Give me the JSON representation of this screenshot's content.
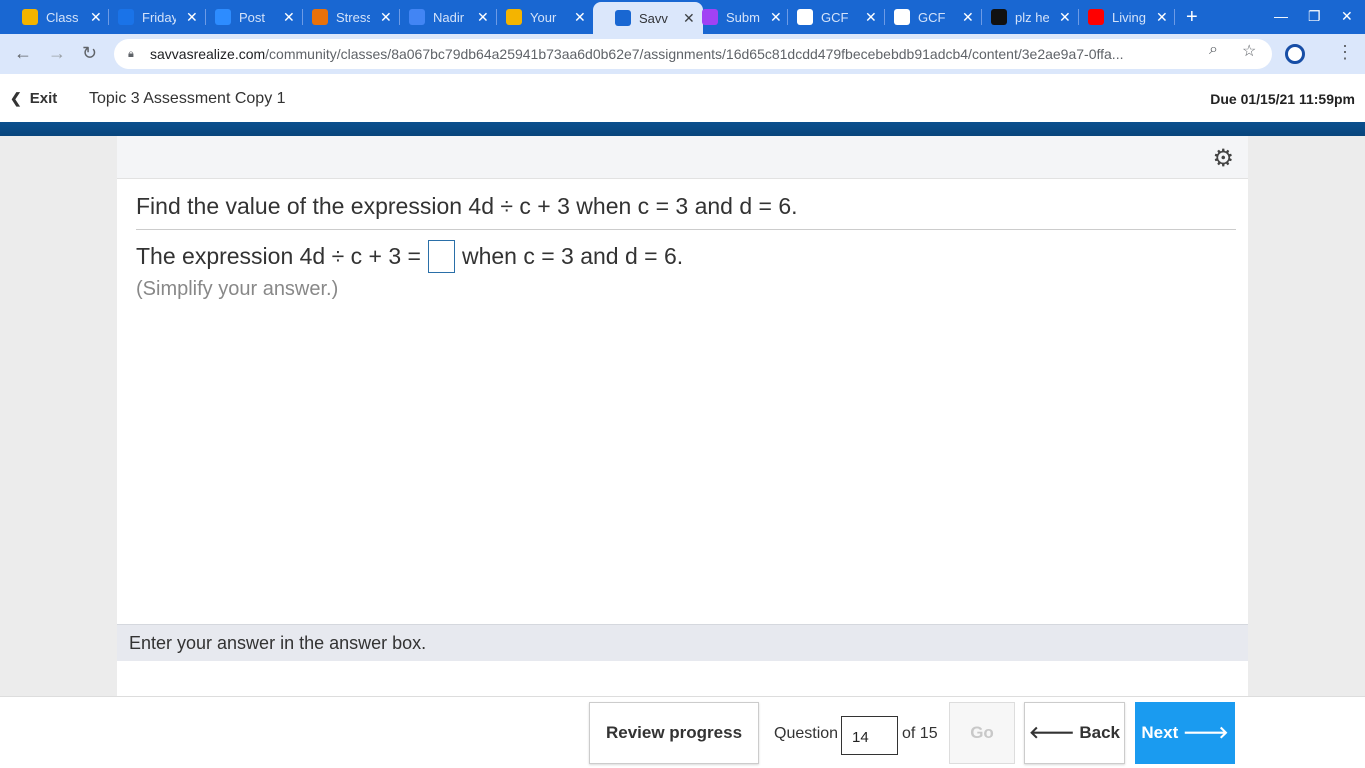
{
  "browser": {
    "tabs": [
      {
        "label": "Class",
        "color": "#f4b400"
      },
      {
        "label": "Friday",
        "color": "#1a73e8"
      },
      {
        "label": "Post",
        "color": "#2d8cff"
      },
      {
        "label": "Stress",
        "color": "#e8710a"
      },
      {
        "label": "Nadir",
        "color": "#4285f4"
      },
      {
        "label": "Your",
        "color": "#f4b400"
      },
      {
        "label": "Savv",
        "color": "#1967d2",
        "active": true
      },
      {
        "label": "Subm",
        "color": "#a142f4"
      },
      {
        "label": "GCF",
        "color": "#ffffff"
      },
      {
        "label": "GCF",
        "color": "#ffffff"
      },
      {
        "label": "plz he",
        "color": "#111111"
      },
      {
        "label": "Living",
        "color": "#ff0000"
      }
    ],
    "url_host": "savvasrealize.com",
    "url_path": "/community/classes/8a067bc79db64a25941b73aa6d0b62e7/assignments/16d65c81dcdd479fbecebebdb91adcb4/content/3e2ae9a7-0ffa..."
  },
  "header": {
    "exit_label": "Exit",
    "title": "Topic 3 Assessment Copy 1",
    "due": "Due 01/15/21 11:59pm"
  },
  "question": {
    "prompt": "Find the value of the expression 4d ÷ c + 3 when c = 3 and d = 6.",
    "answer_prefix": "The expression 4d ÷ c + 3 =",
    "answer_suffix": "when c = 3 and d = 6.",
    "hint": "(Simplify your answer.)",
    "instruction": "Enter your answer in the answer box."
  },
  "footer": {
    "review_label": "Review progress",
    "question_label": "Question",
    "question_number": "14",
    "of_total": "of 15",
    "go_label": "Go",
    "back_label": "Back",
    "next_label": "Next"
  }
}
